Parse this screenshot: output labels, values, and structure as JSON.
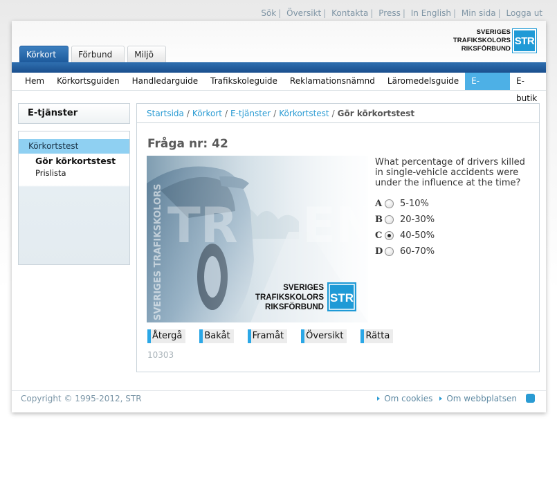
{
  "top_links": [
    "Sök",
    "Översikt",
    "Kontakta",
    "Press",
    "In English",
    "Min sida",
    "Logga ut"
  ],
  "tabs": [
    "Körkort",
    "Förbund",
    "Miljö"
  ],
  "logo": {
    "line1": "SVERIGES",
    "line2": "TRAFIKSKOLORS",
    "line3": "RIKSFÖRBUND",
    "mark": "STR"
  },
  "nav": [
    "Hem",
    "Körkortsguiden",
    "Handledarguide",
    "Trafikskoleguide",
    "Reklamationsnämnd",
    "Läromedelsguide",
    "E-tjänster",
    "E-butik"
  ],
  "sidebar": {
    "title": "E-tjänster",
    "category": "Körkortstest",
    "items": [
      "Gör körkortstest",
      "Prislista"
    ]
  },
  "breadcrumb": {
    "links": [
      "Startsida",
      "Körkort",
      "E-tjänster",
      "Körkortstest"
    ],
    "current": "Gör körkortstest",
    "separator": "/"
  },
  "question": {
    "number_label": "Fråga nr: 42",
    "text": "What percentage of drivers killed in single-vehicle accidents were under the influence at the time?",
    "options": [
      {
        "letter": "A",
        "text": "5-10%",
        "selected": false
      },
      {
        "letter": "B",
        "text": "20-30%",
        "selected": false
      },
      {
        "letter": "C",
        "text": "40-50%",
        "selected": true
      },
      {
        "letter": "D",
        "text": "60-70%",
        "selected": false
      }
    ],
    "image_vertical_text": "SVERIGES TRAFIKSKOLORS"
  },
  "buttons": [
    "Återgå",
    "Bakåt",
    "Framåt",
    "Översikt",
    "Rätta"
  ],
  "code": "10303",
  "footer": {
    "copyright": "Copyright © 1995-2012, STR",
    "links": [
      "Om cookies",
      "Om webbplatsen"
    ]
  },
  "colors": {
    "brand_blue": "#1d5a9c",
    "accent_cyan": "#4db0e6",
    "link": "#2a9bd3"
  }
}
